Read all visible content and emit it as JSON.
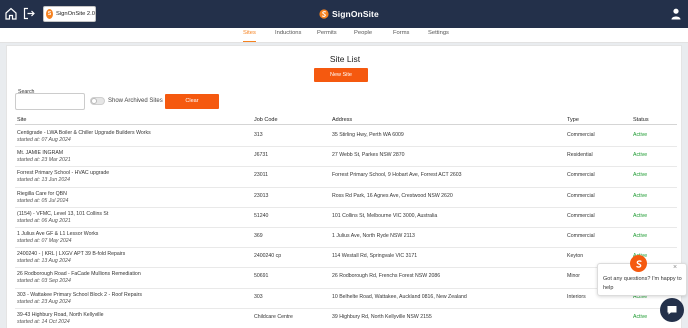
{
  "header": {
    "app_badge_label": "SignOnSite 2.0",
    "brand_name": "SignOnSite",
    "colors": {
      "navbar": "#23304a",
      "accent": "#f58220"
    }
  },
  "subnav": {
    "tabs": [
      {
        "label": "Sites",
        "active": true
      },
      {
        "label": "Inductions",
        "active": false
      },
      {
        "label": "Permits",
        "active": false
      },
      {
        "label": "People",
        "active": false
      },
      {
        "label": "Forms",
        "active": false
      },
      {
        "label": "Settings",
        "active": false
      }
    ]
  },
  "main": {
    "title": "Site List",
    "new_site_label": "New Site",
    "search": {
      "label": "Search",
      "value": ""
    },
    "archived_toggle": {
      "label": "Show Archived Sites",
      "checked": false
    },
    "clear_label": "Clear",
    "table": {
      "columns": [
        "Site",
        "Job Code",
        "Address",
        "Type",
        "Status"
      ],
      "rows": [
        {
          "site": "Centigrade - LWA Boiler & Chiller Upgrade Builders Works",
          "started": "started at: 07 Aug 2024",
          "job_code": "313",
          "address": "35 Stirling Hwy, Perth WA 6009",
          "type": "Commercial",
          "status": "Active"
        },
        {
          "site": "Mt. JAMIE INGRAM",
          "started": "started at: 23 Mar 2021",
          "job_code": "J6731",
          "address": "27 Webb St, Parkes NSW 2870",
          "type": "Residential",
          "status": "Active"
        },
        {
          "site": "Forrest Primary School - HVAC upgrade",
          "started": "started at: 13 Jun 2024",
          "job_code": "23011",
          "address": "Forrest Primary School, 9 Hobart Ave, Forrest ACT 2603",
          "type": "Commercial",
          "status": "Active"
        },
        {
          "site": "Riegilla Care for QBN",
          "started": "started at: 05 Jul 2024",
          "job_code": "23013",
          "address": "Ross Rd Park, 16 Agnes Ave, Crestwood NSW 2620",
          "type": "Commercial",
          "status": "Active"
        },
        {
          "site": "(1154) - VFMC, Level 13, 101 Collins St",
          "started": "started at: 06 Aug 2021",
          "job_code": "51240",
          "address": "101 Collins St, Melbourne VIC 3000, Australia",
          "type": "Commercial",
          "status": "Active"
        },
        {
          "site": "1 Julius Ave GF & L1 Lessor Works",
          "started": "started at: 07 May 2024",
          "job_code": "369",
          "address": "1 Julius Ave, North Ryde NSW 2113",
          "type": "Commercial",
          "status": "Active"
        },
        {
          "site": "2400240 - | KRL | LXGV APT 39 B-fold Repairs",
          "started": "started at: 13 Aug 2024",
          "job_code": "2400240 cp",
          "address": "114 Westall Rd, Springvale VIC 3171",
          "type": "Keyton",
          "status": "Active"
        },
        {
          "site": "26 Rodborough Road - FaCade Mullions Remediation",
          "started": "started at: 03 Sep 2024",
          "job_code": "50691",
          "address": "26 Rodborough Rd, Frenchs Forest NSW 2086",
          "type": "Minor",
          "status": "Active"
        },
        {
          "site": "303 - Wattakee Primary School Block 2 - Roof Repairs",
          "started": "started at: 23 Aug 2024",
          "job_code": "303",
          "address": "10 Belhelte Road, Wattakee, Auckland 0816, New Zealand",
          "type": "Interiors",
          "status": "Active"
        },
        {
          "site": "39-43 Highbury Road, North Kellyville",
          "started": "started at: 14 Oct 2024",
          "job_code": "Childcare Centre",
          "address": "39 Highbury Rd, North Kellyville NSW 2155",
          "type": "",
          "status": "Active"
        }
      ]
    }
  },
  "chat": {
    "message": "Got any questions? I'm happy to help",
    "close_glyph": "×"
  }
}
